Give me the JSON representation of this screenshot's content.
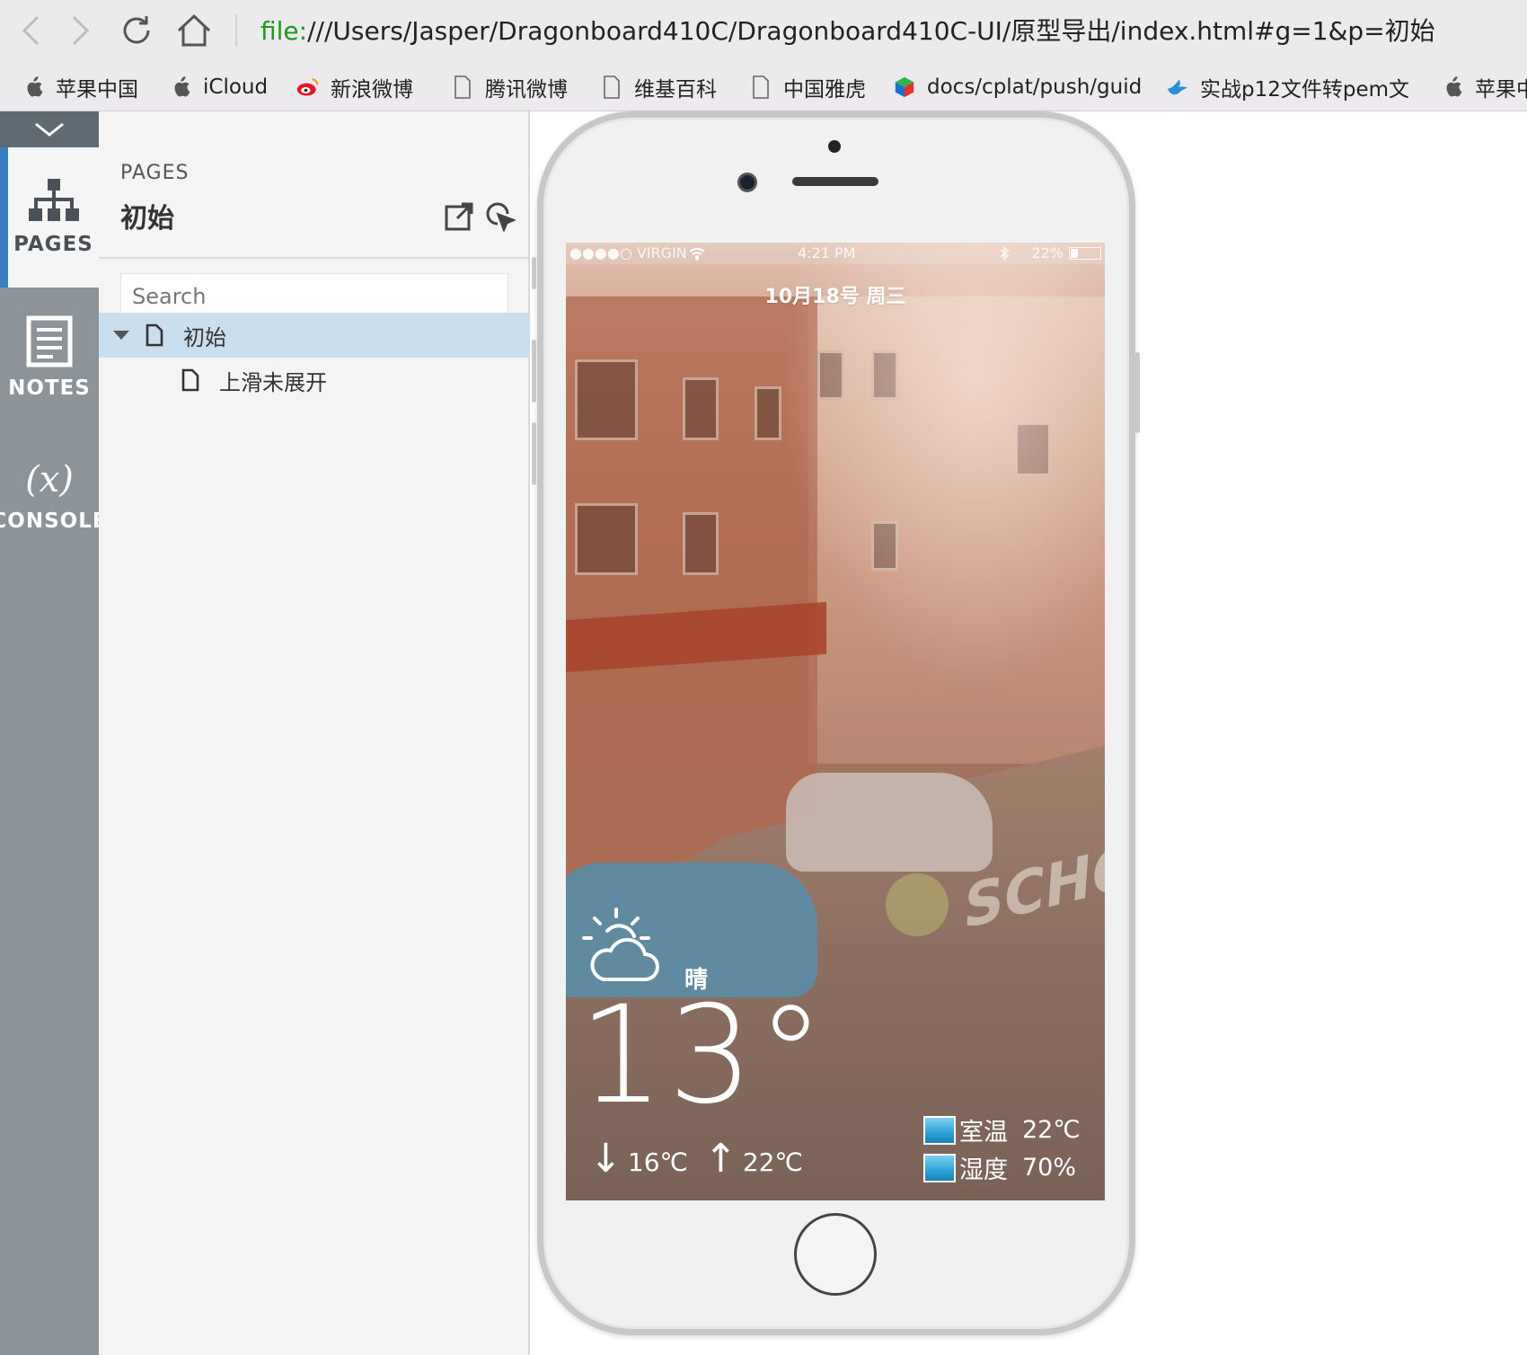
{
  "browser": {
    "address": {
      "scheme": "file:",
      "path": "///Users/Jasper/Dragonboard410C/Dragonboard410C-UI/原型导出/index.html#g=1&p=初始"
    },
    "bookmarks": [
      {
        "label": "苹果中国",
        "icon": "apple-icon"
      },
      {
        "label": "iCloud",
        "icon": "apple-icon"
      },
      {
        "label": "新浪微博",
        "icon": "weibo-icon"
      },
      {
        "label": "腾讯微博",
        "icon": "page-icon"
      },
      {
        "label": "维基百科",
        "icon": "page-icon"
      },
      {
        "label": "中国雅虎",
        "icon": "page-icon"
      },
      {
        "label": "docs/cplat/push/guid",
        "icon": "cube-icon"
      },
      {
        "label": "实战p12文件转pem文",
        "icon": "bird-icon"
      },
      {
        "label": "苹果中",
        "icon": "apple-icon"
      }
    ]
  },
  "rail": {
    "tabs": [
      {
        "label": "PAGES",
        "icon": "sitemap-icon",
        "active": true
      },
      {
        "label": "NOTES",
        "icon": "notes-icon",
        "active": false
      },
      {
        "label": "CONSOLE",
        "icon": "variable-icon",
        "symbol": "(x)",
        "active": false
      }
    ]
  },
  "panel": {
    "subtitle": "PAGES",
    "title": "初始",
    "search_placeholder": "Search",
    "tree": [
      {
        "label": "初始",
        "selected": true,
        "level": 0,
        "expanded": true
      },
      {
        "label": "上滑未展开",
        "selected": false,
        "level": 1
      }
    ]
  },
  "phone": {
    "status": {
      "carrier": "●●●●○ VIRGIN",
      "time": "4:21 PM",
      "battery": "22%"
    },
    "date": "10月18号 周三",
    "condition": "晴",
    "temperature": "13°",
    "low": "16℃",
    "high": "22℃",
    "indoor_temp_label": "室温",
    "indoor_temp": "22℃",
    "humidity_label": "湿度",
    "humidity": "70%",
    "road_text": "SCHO"
  },
  "colors": {
    "rail": "#8c949a",
    "rail_active_border": "#3b7fc0",
    "tree_selected": "#c9dff0",
    "address_scheme": "#1a9b1a"
  }
}
